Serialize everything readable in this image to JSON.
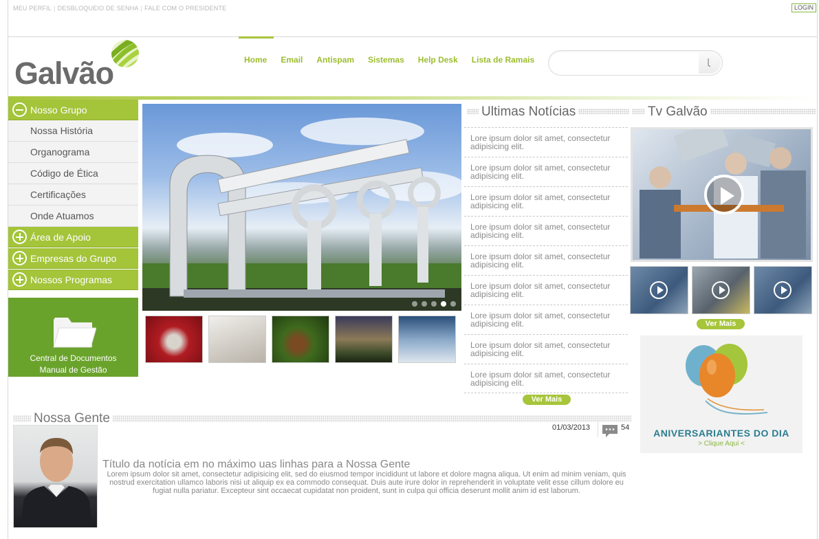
{
  "topbar": {
    "links": [
      "MEU PERFIL",
      "DESBLOQUEIO DE SENHA",
      "FALE COM O PRESIDENTE"
    ],
    "login": "LOGIN"
  },
  "logo": {
    "text": "Galvão"
  },
  "nav": {
    "items": [
      "Home",
      "Email",
      "Antispam",
      "Sistemas",
      "Help Desk",
      "Lista de Ramais"
    ],
    "active": "Home"
  },
  "search": {
    "value": "",
    "placeholder": ""
  },
  "sidebar": {
    "group_open": "Nosso Grupo",
    "sub_items": [
      "Nossa História",
      "Organograma",
      "Código de Ética",
      "Certificações",
      "Onde Atuamos"
    ],
    "groups_closed": [
      "Área de Apoio",
      "Empresas do Grupo",
      "Nossos Programas"
    ],
    "docs_line1": "Central de Documentos",
    "docs_line2": "Manual de Gestão"
  },
  "news": {
    "title": "Ultimas Notícias",
    "items": [
      "Lore ipsum dolor sit amet, consectetur adipisicing elit.",
      "Lore ipsum dolor sit amet, consectetur adipisicing elit.",
      "Lore ipsum dolor sit amet, consectetur adipisicing elit.",
      "Lore ipsum dolor sit amet, consectetur adipisicing elit.",
      "Lore ipsum dolor sit amet, consectetur adipisicing elit.",
      "Lore ipsum dolor sit amet, consectetur adipisicing elit.",
      "Lore ipsum dolor sit amet, consectetur adipisicing elit.",
      "Lore ipsum dolor sit amet, consectetur adipisicing elit.",
      "Lore ipsum dolor sit amet, consectetur adipisicing elit."
    ],
    "more": "Ver Mais"
  },
  "tv": {
    "title": "Tv Galvão",
    "more": "Ver Mais"
  },
  "birthday": {
    "title": "ANIVERSARIANTES DO DIA",
    "link": "> Clique Aqui <"
  },
  "nossa_gente": {
    "title": "Nossa Gente",
    "date": "01/03/2013",
    "comments": "54",
    "headline": "Título da notícia em no máximo uas linhas para a Nossa Gente",
    "body": "Lorem ipsum dolor sit amet, consectetur adipisicing elit, sed do eiusmod tempor incididunt ut labore et dolore magna aliqua. Ut enim ad minim veniam, quis nostrud exercitation ullamco laboris nisi ut aliquip ex ea commodo consequat. Duis aute irure dolor in reprehenderit in voluptate velit esse cillum dolore eu fugiat nulla pariatur. Excepteur sint occaecat cupidatat non proident, sunt in culpa qui officia deserunt mollit anim id est laborum."
  },
  "colors": {
    "brand_green": "#a4c43a",
    "doc_green": "#6aa32c",
    "brand_teal": "#2c7d90"
  }
}
